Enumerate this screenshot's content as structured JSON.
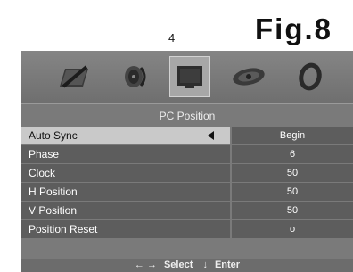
{
  "page_number": "4",
  "figure_label": "Fig.8",
  "menu": {
    "icons": [
      {
        "name": "picture-icon",
        "selected": false
      },
      {
        "name": "sound-icon",
        "selected": false
      },
      {
        "name": "pc-position-icon",
        "selected": true
      },
      {
        "name": "setup-icon",
        "selected": false
      },
      {
        "name": "option-icon",
        "selected": false
      }
    ],
    "title": "PC Position",
    "rows": [
      {
        "label": "Auto Sync",
        "value": "Begin",
        "active": true
      },
      {
        "label": "Phase",
        "value": "6"
      },
      {
        "label": "Clock",
        "value": "50"
      },
      {
        "label": "H Position",
        "value": "50"
      },
      {
        "label": "V Position",
        "value": "50"
      },
      {
        "label": "Position Reset",
        "value": "ο"
      }
    ]
  },
  "footer": {
    "select_label": "Select",
    "enter_label": "Enter",
    "select_glyph": "← →",
    "enter_glyph": "↓"
  }
}
